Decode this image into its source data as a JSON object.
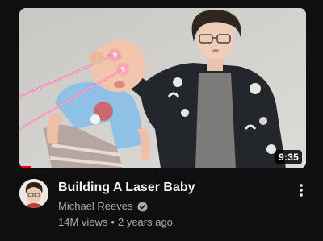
{
  "video": {
    "title": "Building A Laser Baby",
    "duration": "9:35",
    "watch_progress_fraction": 0.04,
    "channel": {
      "name": "Michael Reeves",
      "verified": true,
      "verified_icon": "check-circle-icon"
    },
    "views": "14M views",
    "separator": "•",
    "age": "2 years ago",
    "more_icon": "vertical-ellipsis-icon"
  },
  "colors": {
    "background": "#0f0f0f",
    "title_text": "#f1f1f1",
    "secondary_text": "#aaaaaa",
    "progress": "#ff0000",
    "laser": "#ff6fa8"
  }
}
